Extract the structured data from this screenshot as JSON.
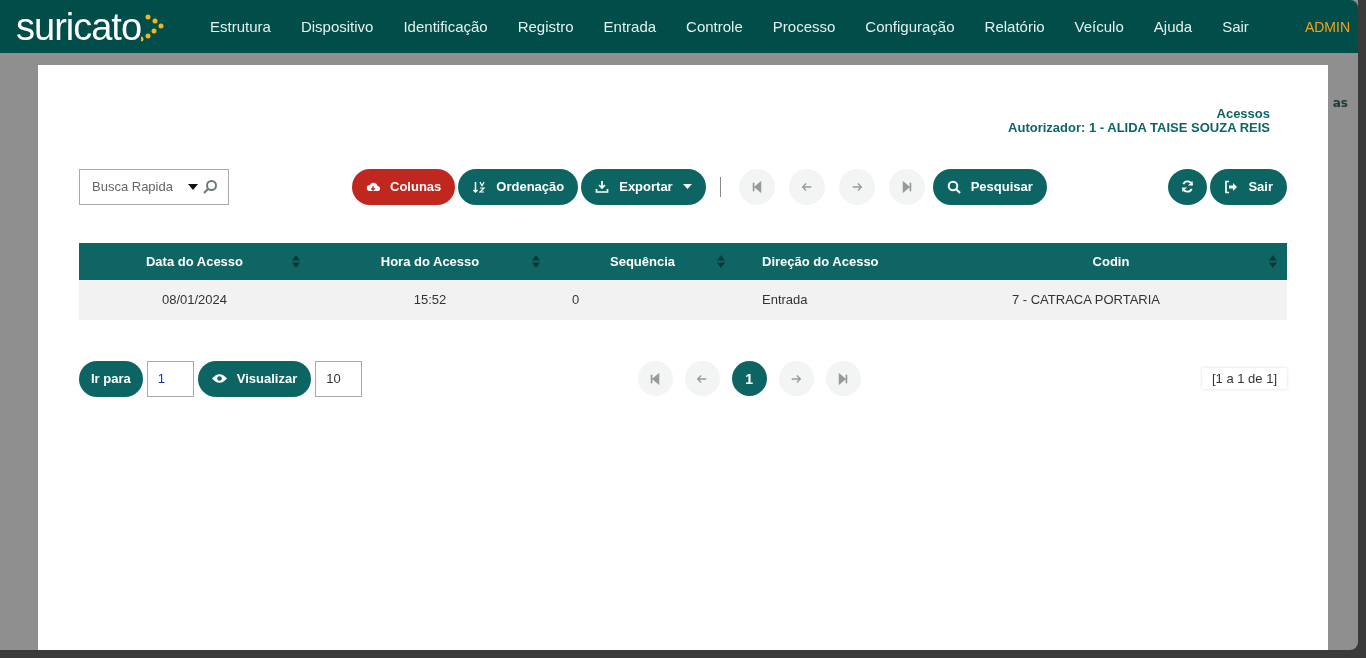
{
  "navbar": {
    "logo": "suricato",
    "menu": [
      "Estrutura",
      "Dispositivo",
      "Identificação",
      "Registro",
      "Entrada",
      "Controle",
      "Processo",
      "Configuração",
      "Relatório",
      "Veículo",
      "Ajuda",
      "Sair"
    ],
    "user": "ADMIN"
  },
  "background_text": "as",
  "dialog": {
    "title": "Acessos",
    "subtitle": "Autorizador: 1 - ALIDA TAISE SOUZA REIS",
    "search": {
      "placeholder": "Busca Rapida"
    },
    "toolbar": [
      {
        "kind": "columns",
        "label": "Colunas"
      },
      {
        "kind": "sort",
        "label": "Ordenação"
      },
      {
        "kind": "export",
        "label": "Exportar"
      }
    ],
    "nav_buttons": [
      {
        "kind": "first",
        "disabled": true
      },
      {
        "kind": "prev",
        "disabled": true
      },
      {
        "kind": "next",
        "disabled": true
      },
      {
        "kind": "last",
        "disabled": true
      }
    ],
    "search_button": "Pesquisar",
    "exit_button": "Sair",
    "table": {
      "columns": [
        {
          "label": "Data do Acesso",
          "sortable": true
        },
        {
          "label": "Hora do Acesso",
          "sortable": true
        },
        {
          "label": "Sequência",
          "sortable": true
        },
        {
          "label": "Direção do Acesso",
          "sortable": false
        },
        {
          "label": "Codin",
          "sortable": true
        }
      ],
      "rows": [
        [
          "08/01/2024",
          "15:52",
          "0",
          "Entrada",
          "7 - CATRACA PORTARIA"
        ]
      ]
    },
    "goto": {
      "label": "Ir para",
      "value": "1"
    },
    "view": {
      "label": "Visualizar",
      "value": "10"
    },
    "pager": [
      {
        "kind": "first",
        "disabled": true
      },
      {
        "kind": "prev",
        "disabled": true
      },
      {
        "kind": "page",
        "label": "1",
        "selected": true
      },
      {
        "kind": "next",
        "disabled": true
      },
      {
        "kind": "last",
        "disabled": true
      }
    ],
    "summary": "[1 a 1 de 1]"
  }
}
